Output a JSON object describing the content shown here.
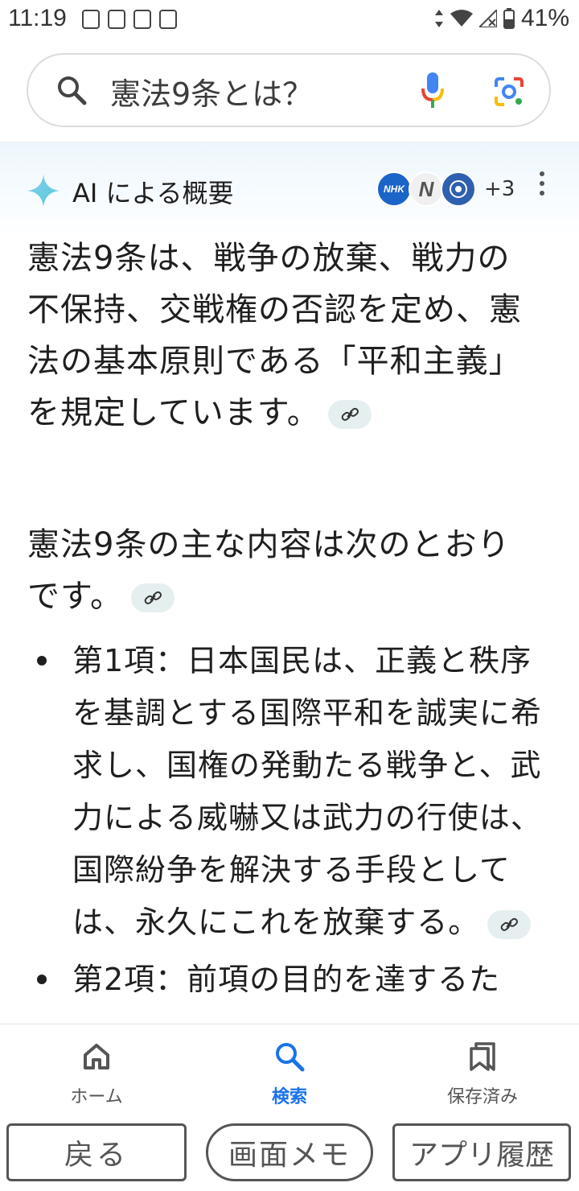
{
  "status_bar": {
    "time": "11:19",
    "battery": "41%",
    "icons": [
      "app-notification-icon",
      "app-notification-icon",
      "app-notification-icon",
      "download-icon",
      "data-arrows-icon",
      "wifi-icon",
      "signal-icon",
      "battery-icon"
    ]
  },
  "search": {
    "query": "憲法9条とは？",
    "icons": [
      "search-icon",
      "mic-icon",
      "lens-icon"
    ]
  },
  "ai_overview": {
    "title": "AI による概要",
    "sources": [
      {
        "label": "NHK",
        "color": "#1b64c8"
      },
      {
        "label": "N",
        "color": "#f0f0f0"
      },
      {
        "label": "",
        "color": "#2f5faf"
      }
    ],
    "more_sources": "+3",
    "paragraph1": "憲法9条は、戦争の放棄、戦力の不保持、交戦権の否認を定め、憲法の基本原則である「平和主義」を規定しています。",
    "paragraph2": "憲法9条の主な内容は次のとおりです。",
    "bullets": [
      "第1項：日本国民は、正義と秩序を基調とする国際平和を誠実に希求し、国権の発動たる戦争と、武力による威嚇又は武力の行使は、国際紛争を解決する手段としては、永久にこれを放棄する。",
      "第2項：前項の目的を達するた"
    ]
  },
  "bottom_nav": {
    "items": [
      {
        "label": "ホーム",
        "icon": "home-icon",
        "active": false
      },
      {
        "label": "検索",
        "icon": "search-icon",
        "active": true
      },
      {
        "label": "保存済み",
        "icon": "bookmarks-icon",
        "active": false
      }
    ],
    "active_color": "#1a73e8"
  },
  "system_buttons": {
    "back": "戻る",
    "memo": "画面メモ",
    "history": "アプリ履歴"
  }
}
